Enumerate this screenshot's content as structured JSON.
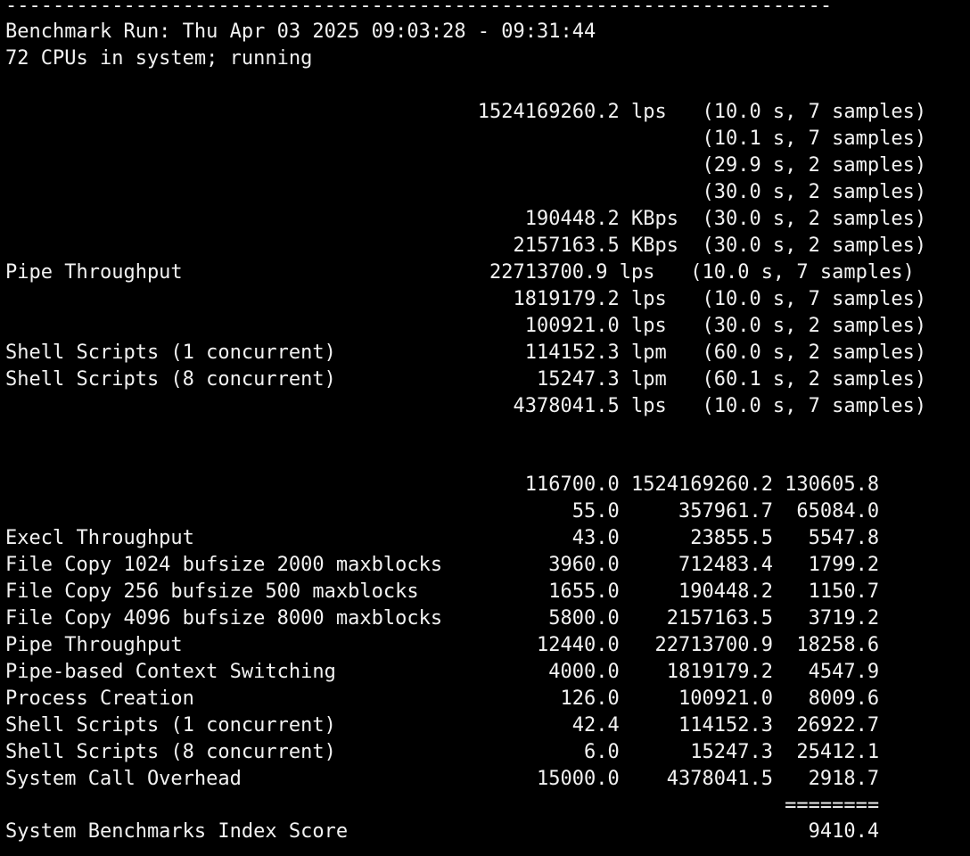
{
  "terminal": {
    "lines": [
      "----------------------------------------------------------------------",
      "Benchmark Run: Thu Apr 03 2025 09:03:28 - 09:31:44",
      "72 CPUs in system; running",
      "",
      "                                        1524169260.2 lps   (10.0 s, 7 samples)",
      "                                                           (10.1 s, 7 samples)",
      "                                                           (29.9 s, 2 samples)",
      "                                                           (30.0 s, 2 samples)",
      "                                            190448.2 KBps  (30.0 s, 2 samples)",
      "                                           2157163.5 KBps  (30.0 s, 2 samples)",
      "Pipe Throughput                          22713700.9 lps   (10.0 s, 7 samples)",
      "                                           1819179.2 lps   (10.0 s, 7 samples)",
      "                                            100921.0 lps   (30.0 s, 2 samples)",
      "Shell Scripts (1 concurrent)                114152.3 lpm   (60.0 s, 2 samples)",
      "Shell Scripts (8 concurrent)                 15247.3 lpm   (60.1 s, 2 samples)",
      "                                           4378041.5 lps   (10.0 s, 7 samples)",
      "",
      "",
      "                                            116700.0 1524169260.2 130605.8",
      "                                                55.0     357961.7  65084.0",
      "Execl Throughput                                43.0      23855.5   5547.8",
      "File Copy 1024 bufsize 2000 maxblocks         3960.0     712483.4   1799.2",
      "File Copy 256 bufsize 500 maxblocks           1655.0     190448.2   1150.7",
      "File Copy 4096 bufsize 8000 maxblocks         5800.0    2157163.5   3719.2",
      "Pipe Throughput                              12440.0   22713700.9  18258.6",
      "Pipe-based Context Switching                  4000.0    1819179.2   4547.9",
      "Process Creation                               126.0     100921.0   8009.6",
      "Shell Scripts (1 concurrent)                    42.4     114152.3  26922.7",
      "Shell Scripts (8 concurrent)                     6.0      15247.3  25412.1",
      "System Call Overhead                         15000.0    4378041.5   2918.7",
      "                                                                  ========",
      "System Benchmarks Index Score                                       9410.4"
    ]
  }
}
